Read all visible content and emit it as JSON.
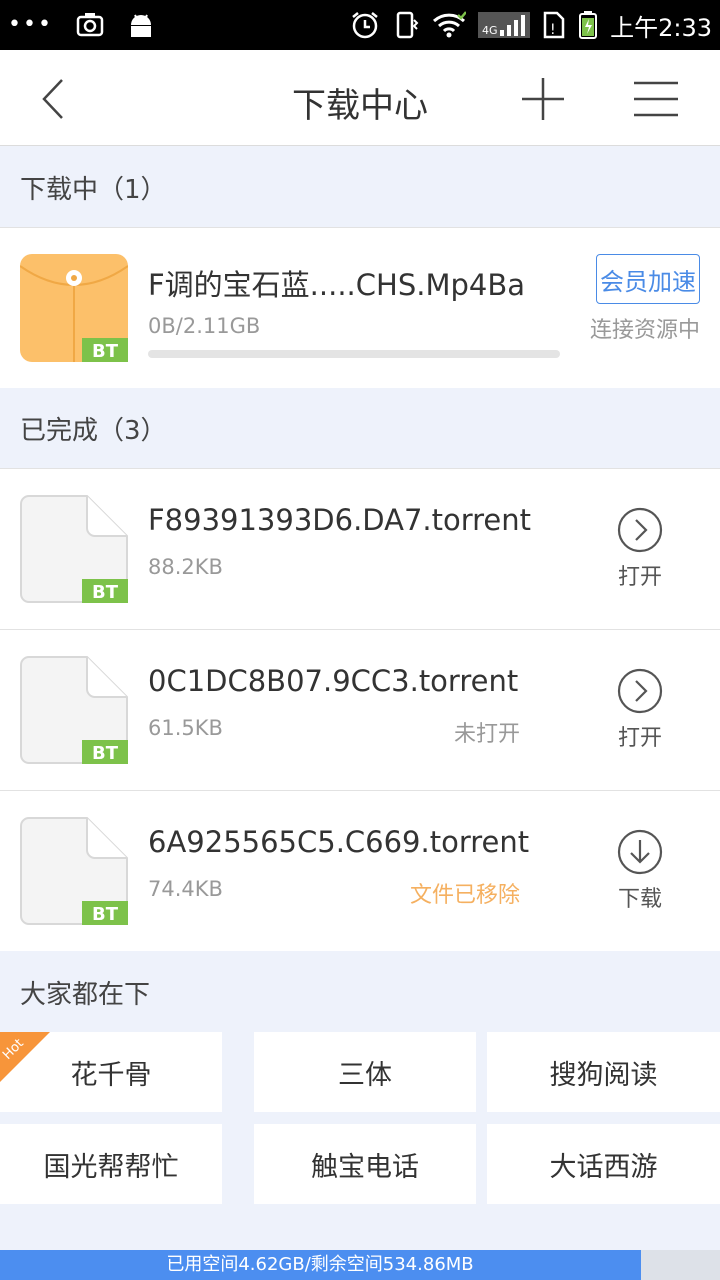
{
  "status_bar": {
    "time": "上午2:33",
    "left_icons": [
      "more-dots-icon",
      "screenshot-icon",
      "android-icon"
    ],
    "right_icons": [
      "alarm-icon",
      "vibrate-icon",
      "wifi-icon",
      "signal-4g-icon",
      "sim-alert-icon",
      "battery-charging-icon"
    ],
    "network_label": "4G"
  },
  "header": {
    "title": "下载中心",
    "icons": [
      "back-icon",
      "add-icon",
      "menu-icon"
    ]
  },
  "downloading": {
    "section_label": "下载中（1）",
    "items": [
      {
        "name": "F调的宝石蓝.....CHS.Mp4Ba",
        "size": "0B/2.11GB",
        "badge": "BT",
        "progress": 0,
        "action_label": "会员加速",
        "status": "连接资源中"
      }
    ]
  },
  "completed": {
    "section_label": "已完成（3）",
    "items": [
      {
        "name": "F89391393D6.DA7.torrent",
        "size": "88.2KB",
        "badge": "BT",
        "status": "",
        "action_label": "打开",
        "action_icon": "chevron-right-circle-icon"
      },
      {
        "name": "0C1DC8B07.9CC3.torrent",
        "size": "61.5KB",
        "badge": "BT",
        "status": "未打开",
        "action_label": "打开",
        "action_icon": "chevron-right-circle-icon"
      },
      {
        "name": "6A925565C5.C669.torrent",
        "size": "74.4KB",
        "badge": "BT",
        "status": "文件已移除",
        "action_label": "下载",
        "action_icon": "download-circle-icon"
      }
    ]
  },
  "popular": {
    "section_label": "大家都在下",
    "hot_label": "Hot",
    "items": [
      "花千骨",
      "三体",
      "搜狗阅读",
      "国光帮帮忙",
      "触宝电话",
      "大话西游"
    ]
  },
  "storage": {
    "text": "已用空间4.62GB/剩余空间534.86MB",
    "used_fraction": 0.89
  },
  "colors": {
    "accent": "#4a8be6",
    "bt_badge": "#7dc24a",
    "folder": "#fcc06a",
    "hot": "#f7953a",
    "removed": "#f5b060"
  }
}
